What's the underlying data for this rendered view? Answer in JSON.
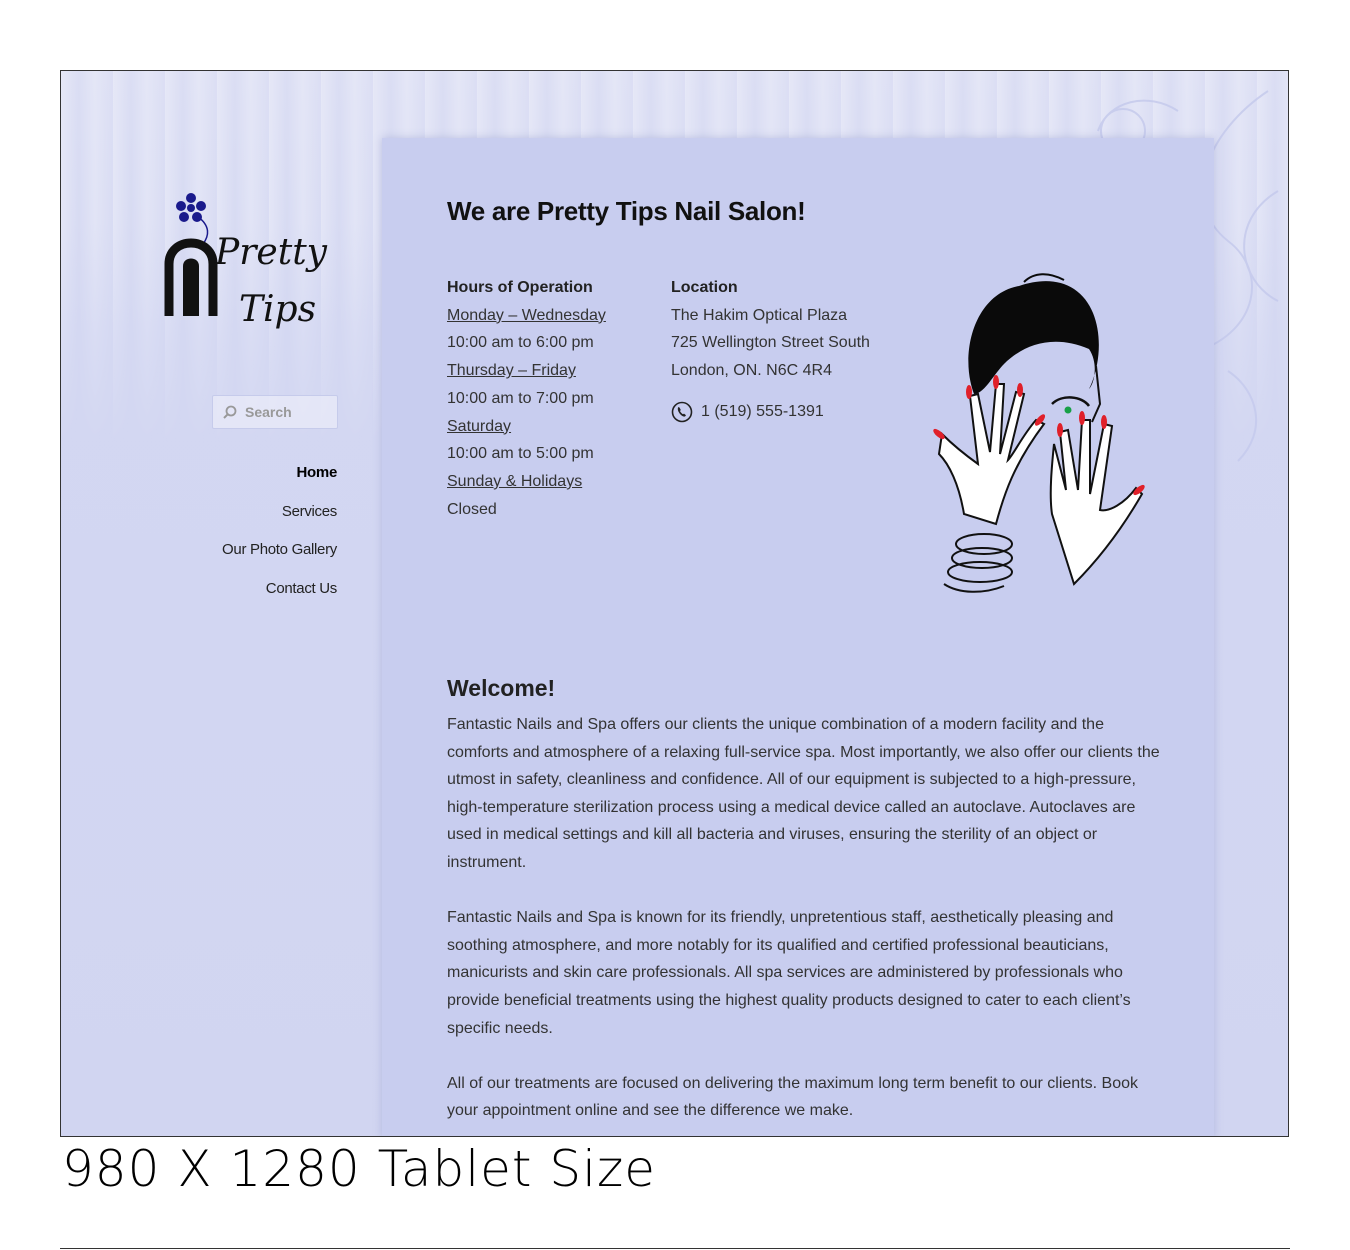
{
  "site": {
    "logo_text_line1": "Pretty",
    "logo_text_line2": "Tips"
  },
  "search": {
    "placeholder": "Search"
  },
  "nav": {
    "items": [
      {
        "label": "Home",
        "active": true
      },
      {
        "label": "Services"
      },
      {
        "label": "Our Photo Gallery"
      },
      {
        "label": "Contact Us"
      }
    ]
  },
  "main": {
    "title": "We are Pretty Tips Nail Salon!",
    "hours": {
      "heading": "Hours of Operation",
      "rows": [
        {
          "days": "Monday – Wednesday",
          "time": "10:00 am to 6:00 pm"
        },
        {
          "days": "Thursday – Friday",
          "time": "10:00 am to 7:00 pm"
        },
        {
          "days": "Saturday",
          "time": "10:00 am to 5:00 pm"
        },
        {
          "days": "Sunday & Holidays",
          "time": "Closed"
        }
      ]
    },
    "location": {
      "heading": "Location",
      "line1": "The Hakim Optical Plaza",
      "line2": "725 Wellington Street South",
      "line3": "London, ON. N6C 4R4",
      "phone": "1 (519) 555-1391"
    },
    "welcome_heading": "Welcome!",
    "paragraphs": [
      "Fantastic Nails and Spa offers our clients the unique combination of a modern facility and the comforts and atmosphere of a relaxing full-service spa. Most importantly, we also offer our clients the utmost in safety, cleanliness and confidence. All of our equipment is subjected to a high-pressure, high-temperature sterilization process using a medical device called an autoclave. Autoclaves are used in medical settings and kill all bacteria and viruses, ensuring the sterility of an object or instrument.",
      "Fantastic Nails and Spa is known for its friendly, unpretentious staff, aesthetically pleasing and soothing atmosphere, and more notably for its qualified and certified professional beauticians, manicurists and skin care professionals. All spa services are administered by professionals who provide beneficial treatments using the highest quality products designed to cater to each client’s specific needs.",
      "All of our treatments are focused on delivering the maximum long term benefit to our clients. Book your appointment online and see the difference we make."
    ]
  },
  "caption": "980 X 1280 Tablet Size",
  "colors": {
    "page_bg": "#d3d7f2",
    "content_bg": "#c8cdef",
    "logo_blue": "#1a1a8c",
    "nail_red": "#e0202a"
  }
}
